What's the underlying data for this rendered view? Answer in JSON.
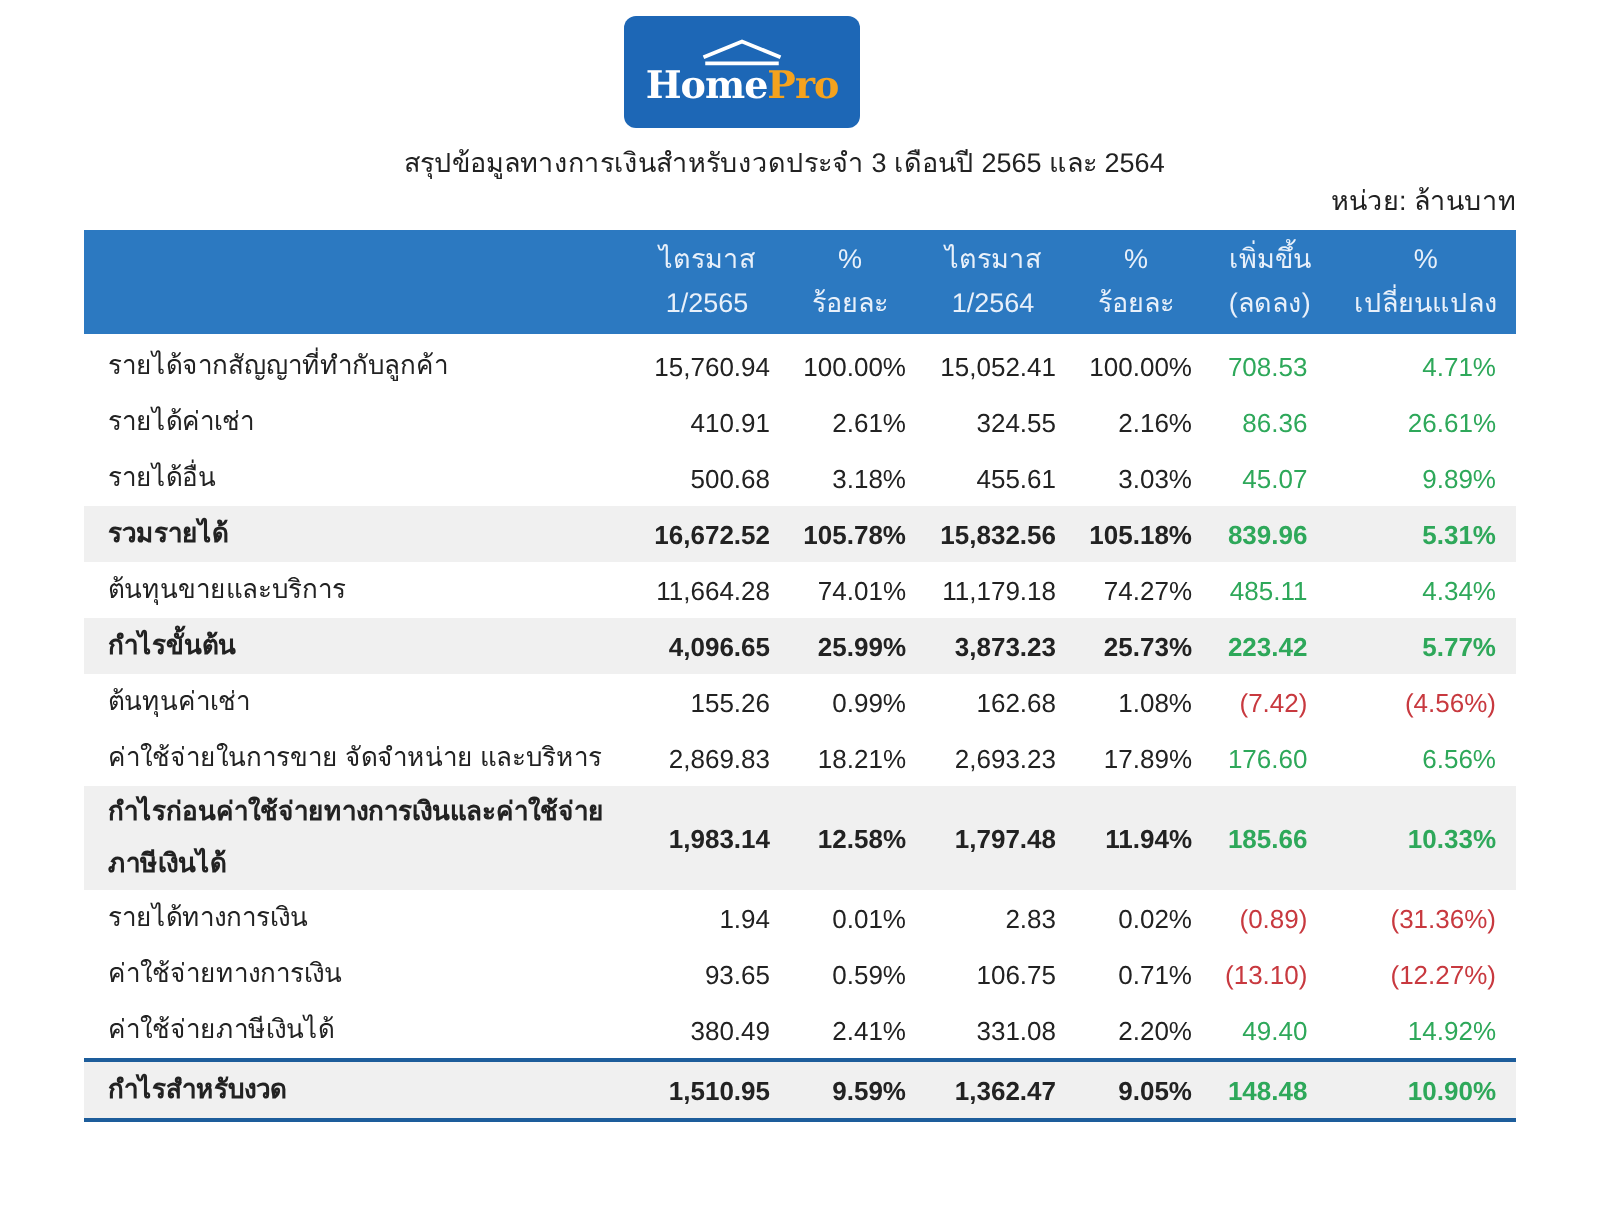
{
  "logo": {
    "word_1": "Home",
    "word_2": "Pro"
  },
  "title": "สรุปข้อมูลทางการเงินสำหรับงวดประจำ 3 เดือนปี 2565 และ 2564",
  "unit": "หน่วย: ล้านบาท",
  "table": {
    "columns": [
      {
        "line_1": "ไตรมาส",
        "line_2": "1/2565"
      },
      {
        "line_1": "%",
        "line_2": "ร้อยละ"
      },
      {
        "line_1": "ไตรมาส",
        "line_2": "1/2564"
      },
      {
        "line_1": "%",
        "line_2": "ร้อยละ"
      },
      {
        "line_1": "เพิ่มขึ้น",
        "line_2": "(ลดลง)"
      },
      {
        "line_1": "%",
        "line_2": "เปลี่ยนแปลง"
      }
    ],
    "rows": [
      {
        "label": "รายได้จากสัญญาที่ทำกับลูกค้า",
        "total": false,
        "color": "#2ea85a",
        "cells": [
          "15,760.94",
          "100.00%",
          "15,052.41",
          "100.00%",
          "708.53",
          "4.71%"
        ]
      },
      {
        "label": "รายได้ค่าเช่า",
        "total": false,
        "color": "#2ea85a",
        "cells": [
          "410.91",
          "2.61%",
          "324.55",
          "2.16%",
          "86.36",
          "26.61%"
        ]
      },
      {
        "label": "รายได้อื่น",
        "total": false,
        "color": "#2ea85a",
        "cells": [
          "500.68",
          "3.18%",
          "455.61",
          "3.03%",
          "45.07",
          "9.89%"
        ]
      },
      {
        "label": "รวมรายได้",
        "total": true,
        "color": "#2ea85a",
        "cells": [
          "16,672.52",
          "105.78%",
          "15,832.56",
          "105.18%",
          "839.96",
          "5.31%"
        ]
      },
      {
        "label": "ต้นทุนขายและบริการ",
        "total": false,
        "color": "#2ea85a",
        "cells": [
          "11,664.28",
          "74.01%",
          "11,179.18",
          "74.27%",
          "485.11",
          "4.34%"
        ]
      },
      {
        "label": "กำไรขั้นต้น",
        "total": true,
        "color": "#2ea85a",
        "cells": [
          "4,096.65",
          "25.99%",
          "3,873.23",
          "25.73%",
          "223.42",
          "5.77%"
        ]
      },
      {
        "label": "ต้นทุนค่าเช่า",
        "total": false,
        "color": "#c8393f",
        "cells": [
          "155.26",
          "0.99%",
          "162.68",
          "1.08%",
          "(7.42)",
          "(4.56%)"
        ]
      },
      {
        "label": "ค่าใช้จ่ายในการขาย จัดจำหน่าย และบริหาร",
        "total": false,
        "color": "#2ea85a",
        "cells": [
          "2,869.83",
          "18.21%",
          "2,693.23",
          "17.89%",
          "176.60",
          "6.56%"
        ]
      },
      {
        "label": "กำไรก่อนค่าใช้จ่ายทางการเงินและค่าใช้จ่ายภาษีเงินได้",
        "total": true,
        "color": "#2ea85a",
        "cells": [
          "1,983.14",
          "12.58%",
          "1,797.48",
          "11.94%",
          "185.66",
          "10.33%"
        ]
      },
      {
        "label": "รายได้ทางการเงิน",
        "total": false,
        "color": "#c8393f",
        "cells": [
          "1.94",
          "0.01%",
          "2.83",
          "0.02%",
          "(0.89)",
          "(31.36%)"
        ]
      },
      {
        "label": "ค่าใช้จ่ายทางการเงิน",
        "total": false,
        "color": "#c8393f",
        "cells": [
          "93.65",
          "0.59%",
          "106.75",
          "0.71%",
          "(13.10)",
          "(12.27%)"
        ]
      },
      {
        "label": "ค่าใช้จ่ายภาษีเงินได้",
        "total": false,
        "color": "#2ea85a",
        "cells": [
          "380.49",
          "2.41%",
          "331.08",
          "2.20%",
          "49.40",
          "14.92%"
        ]
      },
      {
        "label": "กำไรสำหรับงวด",
        "total": true,
        "color": "#2ea85a",
        "cells": [
          "1,510.95",
          "9.59%",
          "1,362.47",
          "9.05%",
          "148.48",
          "10.90%"
        ]
      }
    ]
  }
}
